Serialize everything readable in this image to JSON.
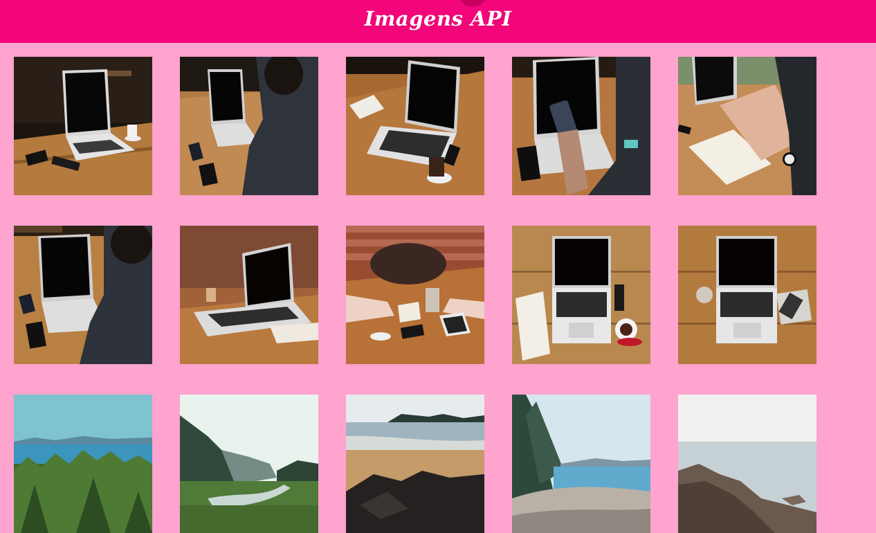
{
  "header": {
    "title": "Imagens API",
    "background": "#f2067a"
  },
  "page": {
    "background": "#ffa3cf"
  },
  "gallery": {
    "rows": [
      [
        {
          "id": "laptop-table-1",
          "kind": "laptop"
        },
        {
          "id": "person-typing-1",
          "kind": "laptop"
        },
        {
          "id": "laptop-notebook-coffee",
          "kind": "laptop"
        },
        {
          "id": "person-phone-laptop",
          "kind": "laptop"
        },
        {
          "id": "hand-writing-notebook",
          "kind": "laptop"
        }
      ],
      [
        {
          "id": "person-typing-2",
          "kind": "laptop"
        },
        {
          "id": "laptop-side-view",
          "kind": "laptop"
        },
        {
          "id": "meeting-table-brick",
          "kind": "table"
        },
        {
          "id": "laptop-top-notebook",
          "kind": "laptop"
        },
        {
          "id": "laptop-top-phone",
          "kind": "laptop"
        }
      ],
      [
        {
          "id": "forest-lake",
          "kind": "landscape"
        },
        {
          "id": "valley-river",
          "kind": "landscape"
        },
        {
          "id": "beach-rocks",
          "kind": "landscape"
        },
        {
          "id": "pebble-shore",
          "kind": "landscape"
        },
        {
          "id": "rocky-coast",
          "kind": "landscape"
        }
      ]
    ]
  }
}
